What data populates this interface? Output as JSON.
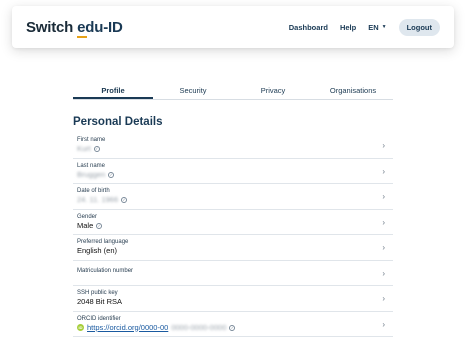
{
  "header": {
    "logo_switch": "Switch",
    "logo_eduid": "edu-ID",
    "nav": {
      "dashboard": "Dashboard",
      "help": "Help",
      "language": "EN",
      "logout": "Logout"
    }
  },
  "tabs": [
    "Profile",
    "Security",
    "Privacy",
    "Organisations"
  ],
  "active_tab": "Profile",
  "section_title": "Personal Details",
  "details": {
    "first_name": {
      "label": "First name",
      "value": "Kurt"
    },
    "last_name": {
      "label": "Last name",
      "value": "Bruggen"
    },
    "dob": {
      "label": "Date of birth",
      "value": "24. 11. 1966"
    },
    "gender": {
      "label": "Gender",
      "value": "Male"
    },
    "language": {
      "label": "Preferred language",
      "value": "English (en)"
    },
    "matriculation": {
      "label": "Matriculation number",
      "value": ""
    },
    "ssh": {
      "label": "SSH public key",
      "value": "2048 Bit RSA"
    },
    "orcid": {
      "label": "ORCID identifier",
      "value_prefix": "https://orcid.org/0000-00",
      "value_blurred": "0000-0000-0000"
    }
  },
  "icons": {
    "verified": "check-circle-icon",
    "chevron": "chevron-right-icon",
    "orcid": "orcid-icon"
  },
  "colors": {
    "brand": "#1a3a55",
    "accent": "#e6a117",
    "orcid": "#a6ce39"
  }
}
